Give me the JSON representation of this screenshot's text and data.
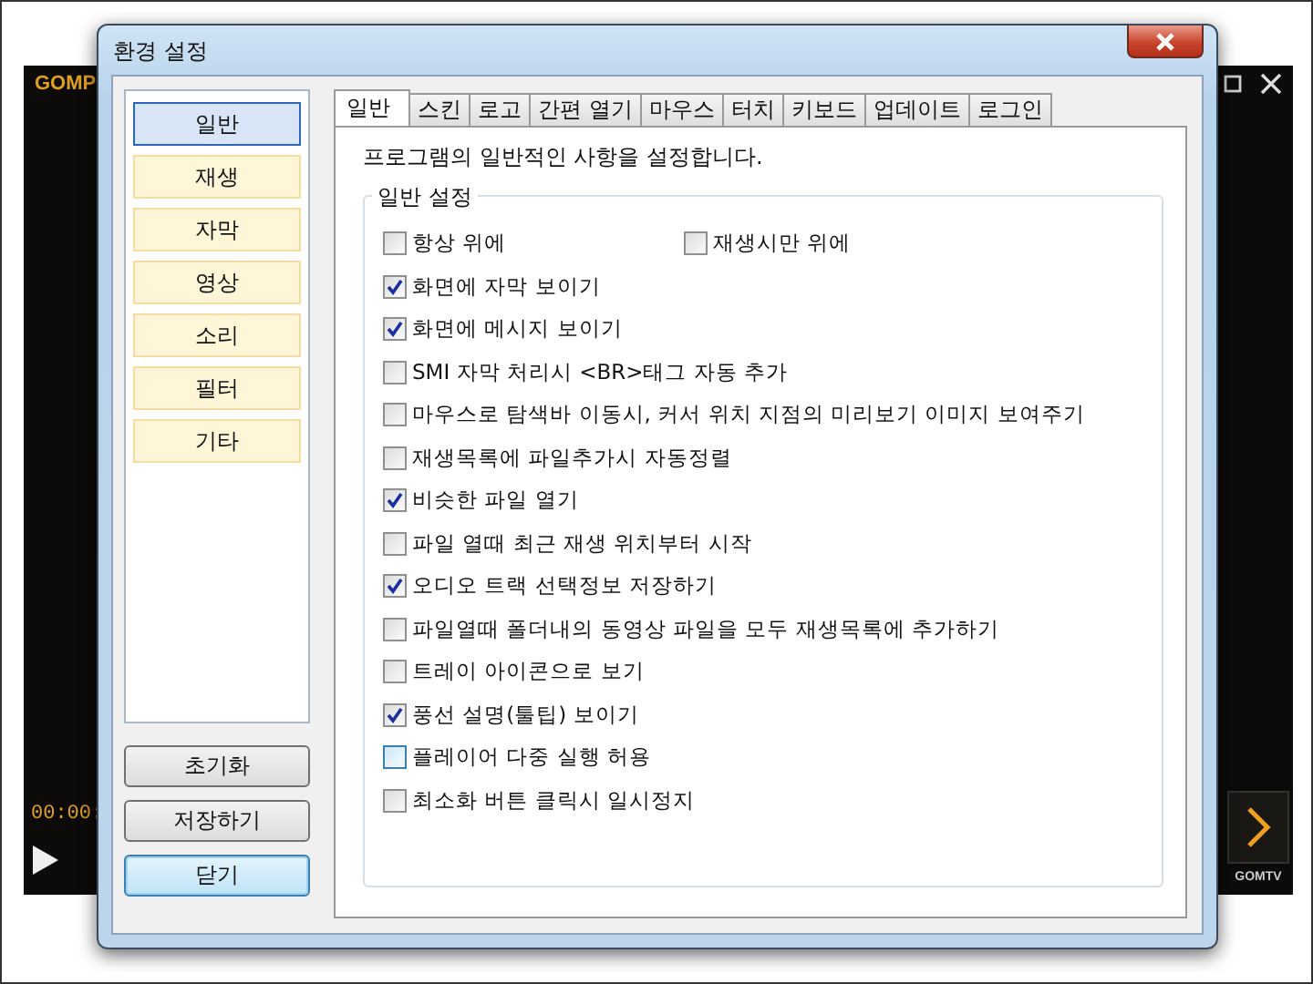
{
  "player": {
    "logo": "GOMP",
    "time": "00:00:",
    "brand": "GOMTV"
  },
  "window": {
    "title": "환경 설정"
  },
  "sidebar": {
    "items": [
      {
        "label": "일반",
        "selected": true
      },
      {
        "label": "재생",
        "selected": false
      },
      {
        "label": "자막",
        "selected": false
      },
      {
        "label": "영상",
        "selected": false
      },
      {
        "label": "소리",
        "selected": false
      },
      {
        "label": "필터",
        "selected": false
      },
      {
        "label": "기타",
        "selected": false
      }
    ]
  },
  "buttons": [
    {
      "label": "초기화",
      "default": false
    },
    {
      "label": "저장하기",
      "default": false
    },
    {
      "label": "닫기",
      "default": true
    }
  ],
  "tabs": [
    {
      "label": "일반",
      "selected": true
    },
    {
      "label": "스킨",
      "selected": false
    },
    {
      "label": "로고",
      "selected": false
    },
    {
      "label": "간편 열기",
      "selected": false
    },
    {
      "label": "마우스",
      "selected": false
    },
    {
      "label": "터치",
      "selected": false
    },
    {
      "label": "키보드",
      "selected": false
    },
    {
      "label": "업데이트",
      "selected": false
    },
    {
      "label": "로그인",
      "selected": false
    }
  ],
  "description": "프로그램의 일반적인 사항을 설정합니다.",
  "group": {
    "title": "일반 설정",
    "rows": [
      [
        {
          "label": "항상 위에",
          "checked": false,
          "focused": false
        },
        {
          "label": "재생시만 위에",
          "checked": false,
          "focused": false
        }
      ],
      [
        {
          "label": "화면에 자막 보이기",
          "checked": true,
          "focused": false
        }
      ],
      [
        {
          "label": "화면에 메시지 보이기",
          "checked": true,
          "focused": false
        }
      ],
      [
        {
          "label": "SMI 자막 처리시 <BR>태그 자동 추가",
          "checked": false,
          "focused": false
        }
      ],
      [
        {
          "label": "마우스로 탐색바 이동시, 커서 위치 지점의 미리보기 이미지 보여주기",
          "checked": false,
          "focused": false
        }
      ],
      [
        {
          "label": "재생목록에 파일추가시 자동정렬",
          "checked": false,
          "focused": false
        }
      ],
      [
        {
          "label": "비슷한 파일 열기",
          "checked": true,
          "focused": false
        }
      ],
      [
        {
          "label": "파일 열때 최근 재생 위치부터 시작",
          "checked": false,
          "focused": false
        }
      ],
      [
        {
          "label": "오디오 트랙 선택정보 저장하기",
          "checked": true,
          "focused": false
        }
      ],
      [
        {
          "label": "파일열때 폴더내의 동영상 파일을 모두 재생목록에 추가하기",
          "checked": false,
          "focused": false
        }
      ],
      [
        {
          "label": "트레이 아이콘으로 보기",
          "checked": false,
          "focused": false
        }
      ],
      [
        {
          "label": "풍선 설명(툴팁) 보이기",
          "checked": true,
          "focused": false
        }
      ],
      [
        {
          "label": "플레이어 다중 실행 허용",
          "checked": false,
          "focused": true
        }
      ],
      [
        {
          "label": "최소화 버튼 클릭시 일시정지",
          "checked": false,
          "focused": false
        }
      ]
    ]
  }
}
